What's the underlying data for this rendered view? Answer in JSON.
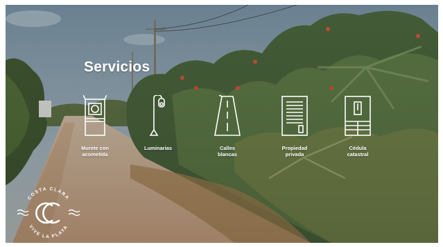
{
  "slide": {
    "title": "Servicios",
    "services": [
      {
        "label": "Murete con\nacometida",
        "icon": "meter-wall-icon"
      },
      {
        "label": "Luminarias",
        "icon": "street-light-icon"
      },
      {
        "label": "Calles\nblancas",
        "icon": "road-icon"
      },
      {
        "label": "Propiedad\nprivada",
        "icon": "property-deed-icon"
      },
      {
        "label": "Cédula\ncatastral",
        "icon": "cadastral-card-icon"
      }
    ],
    "logo": {
      "top_text": "COSTA CLARA",
      "bottom_text": "VIVE LA PLAYA",
      "icon": "costa-clara-logo"
    },
    "colors": {
      "text": "#ffffff",
      "sky": "#7f97a6",
      "road": "#c9a98a",
      "foliage": "#3e5a2e"
    }
  }
}
